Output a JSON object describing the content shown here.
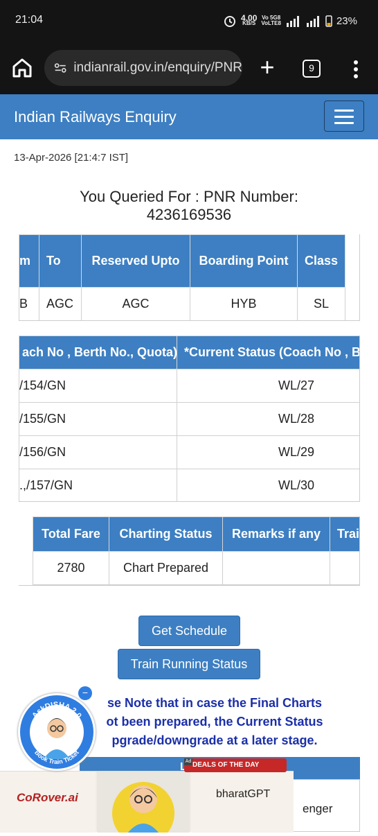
{
  "status_bar": {
    "time": "21:04",
    "net_speed": "4.00",
    "net_unit": "KB/S",
    "volte_top": "Vo 5G8",
    "volte_bottom": "VoLTE8",
    "network": "5G",
    "battery": "23%"
  },
  "browser": {
    "url": "indianrail.gov.in/enquiry/PNR",
    "tab_count": "9"
  },
  "header": {
    "title": "Indian Railways Enquiry"
  },
  "page": {
    "date": "13-Apr-2026 [21:4:7 IST]",
    "query_line1": "You Queried For : PNR Number:",
    "query_line2": "4236169536"
  },
  "journey_table": {
    "headers": [
      "m",
      "To",
      "Reserved Upto",
      "Boarding Point",
      "Class"
    ],
    "row": [
      "B",
      "AGC",
      "AGC",
      "HYB",
      "SL"
    ]
  },
  "passenger_table": {
    "headers": [
      "ach No , Berth No., Quota)",
      "*Current Status (Coach No , B"
    ],
    "rows": [
      [
        " /154/GN",
        "WL/27"
      ],
      [
        " /155/GN",
        "WL/28"
      ],
      [
        " /156/GN",
        "WL/29"
      ],
      [
        ".,/157/GN",
        "WL/30"
      ]
    ]
  },
  "fare_table": {
    "headers": [
      "Total Fare",
      "Charting Status",
      "Remarks if any",
      "Trai"
    ],
    "row": [
      "2780",
      "Chart Prepared",
      "",
      ""
    ]
  },
  "buttons": {
    "get_schedule": "Get Schedule",
    "train_running": "Train Running Status"
  },
  "note": {
    "line1": "se Note that in case the Final Charts",
    "line2": "ot been prepared, the Current Status",
    "line3": "pgrade/downgrade at a later stage."
  },
  "legend": {
    "label": "LE",
    "passenger": "enger"
  },
  "disha": {
    "arc_text": "AskDISHA 2.0",
    "bottom_text": "Book Train Ticket"
  },
  "ad": {
    "tag": "DEALS OF THE DAY",
    "badge": "Ad",
    "left_brand": "CoRover.ai",
    "right_brand": "bharatGPT"
  }
}
